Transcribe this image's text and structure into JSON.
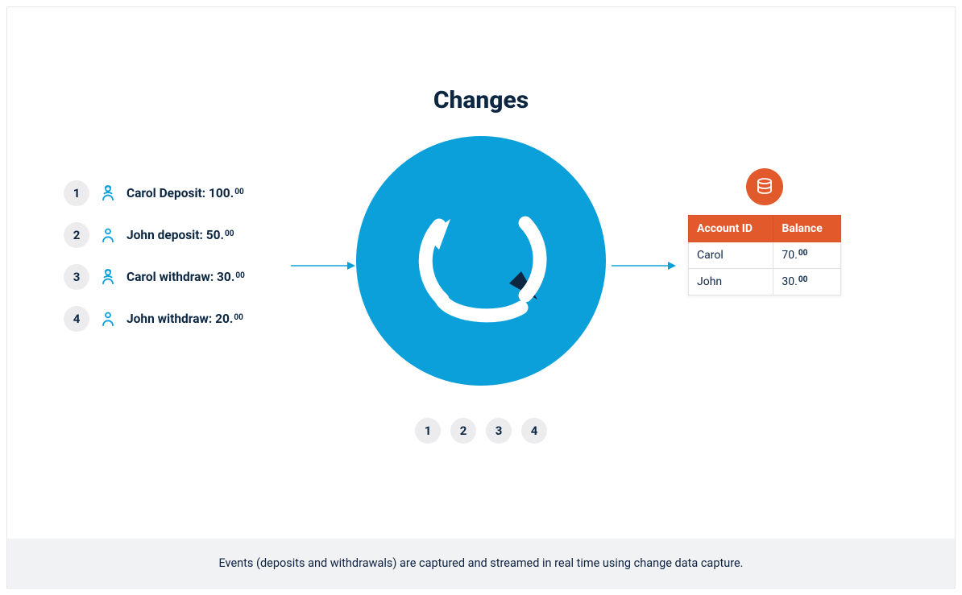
{
  "title": "Changes",
  "events": [
    {
      "n": "1",
      "who": "Carol",
      "label": "Carol Deposit: 100.",
      "cents": "00",
      "gender": "f"
    },
    {
      "n": "2",
      "who": "John",
      "label": "John deposit: 50.",
      "cents": "00",
      "gender": "m"
    },
    {
      "n": "3",
      "who": "Carol",
      "label": "Carol withdraw: 30.",
      "cents": "00",
      "gender": "f"
    },
    {
      "n": "4",
      "who": "John",
      "label": "John withdraw: 20.",
      "cents": "00",
      "gender": "m"
    }
  ],
  "steps": [
    "1",
    "2",
    "3",
    "4"
  ],
  "table": {
    "headers": [
      "Account ID",
      "Balance"
    ],
    "rows": [
      {
        "id": "Carol",
        "bal": "70.",
        "cents": "00"
      },
      {
        "id": "John",
        "bal": "30.",
        "cents": "00"
      }
    ]
  },
  "caption": "Events (deposits and withdrawals) are captured and streamed in real time using change data capture.",
  "icons": {
    "change": "change-arrows-icon",
    "database": "database-icon",
    "personF": "person-female-icon",
    "personM": "person-male-icon",
    "arrow": "arrow-right-icon"
  },
  "colors": {
    "blue": "#0ca0db",
    "navy": "#0d2743",
    "orange": "#e25a2b",
    "light": "#ececee"
  }
}
